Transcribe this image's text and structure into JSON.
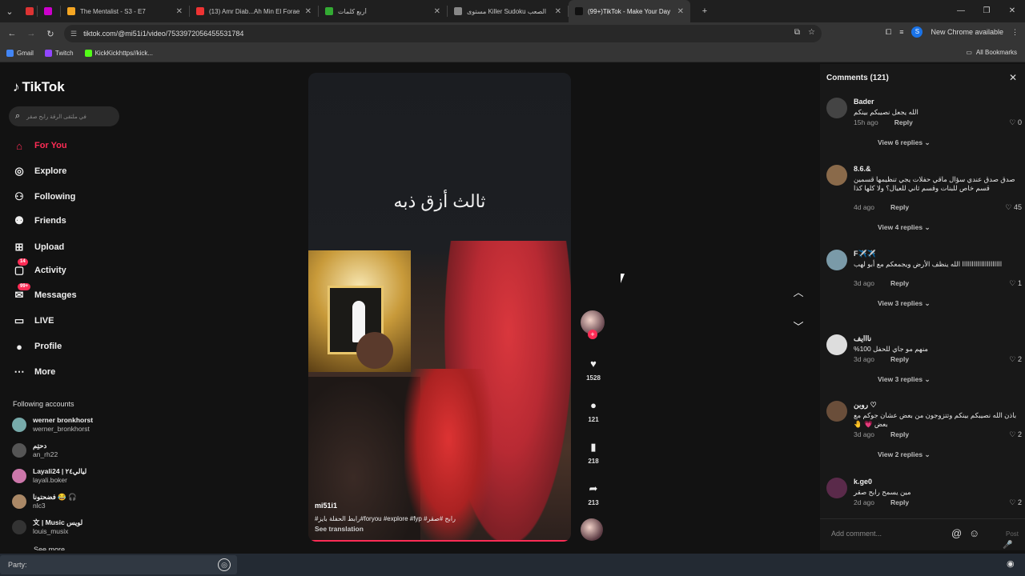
{
  "browser": {
    "tabs": [
      {
        "title": "",
        "color": "#d33"
      },
      {
        "title": "",
        "color": "#c0c"
      },
      {
        "title": "The Mentalist - S3 - E7",
        "color": "#f5a623"
      },
      {
        "title": "(13) Amr Diab...Ah Min El Forae",
        "color": "#e33"
      },
      {
        "title": "أربع كلمات",
        "color": "#3a3"
      },
      {
        "title": "مستوى Killer Sudoku الصعب",
        "color": "#888"
      },
      {
        "title": "(99+)TikTok - Make Your Day",
        "color": "#111"
      }
    ],
    "url": "tiktok.com/@mi51i1/video/7533972056455531784",
    "profile_letter": "S",
    "new_chrome": "New Chrome available",
    "bookmarks": [
      {
        "label": "Gmail",
        "color": "#4285f4"
      },
      {
        "label": "Twitch",
        "color": "#9146ff"
      },
      {
        "label": "KickKickhttps//kick...",
        "color": "#53fc18"
      }
    ],
    "all_bookmarks": "All Bookmarks"
  },
  "sidebar": {
    "logo": "TikTok",
    "search_placeholder": "في ملتقى الرقة رابح صقر",
    "nav": [
      {
        "label": "For You",
        "icon": "home-icon"
      },
      {
        "label": "Explore",
        "icon": "compass-icon"
      },
      {
        "label": "Following",
        "icon": "following-icon"
      },
      {
        "label": "Friends",
        "icon": "friends-icon"
      },
      {
        "label": "Upload",
        "icon": "upload-icon"
      },
      {
        "label": "Activity",
        "icon": "activity-icon",
        "badge": "14"
      },
      {
        "label": "Messages",
        "icon": "messages-icon",
        "badge": "99+"
      },
      {
        "label": "LIVE",
        "icon": "live-icon"
      },
      {
        "label": "Profile",
        "icon": "profile-icon"
      },
      {
        "label": "More",
        "icon": "more-icon"
      }
    ],
    "following_title": "Following accounts",
    "following": [
      {
        "name": "werner bronkhorst",
        "user": "werner_bronkhorst"
      },
      {
        "name": "دحتِم",
        "user": "an_rh22"
      },
      {
        "name": "Layali24 | ليالي٢٤",
        "user": "layali.boker"
      },
      {
        "name": "فضحتونا 😂 🎧",
        "user": "nlc3"
      },
      {
        "name": "文 | Music لويس",
        "user": "louis_musix"
      }
    ],
    "see_more": "See more"
  },
  "video": {
    "overlay_text": "ثالث أزق ذبه",
    "author": "mi51i1",
    "caption": "#رابط الحفلة بايز#foryou #explore #fyp #رابح #صقر",
    "see_translation": "See translation",
    "likes": "1528",
    "comments": "121",
    "saves": "218",
    "shares": "213"
  },
  "comments": {
    "title": "Comments (121)",
    "input_placeholder": "Add comment...",
    "post": "Post",
    "items": [
      {
        "author": "Bader",
        "text": "الله يجعل نصيبكم بينكم",
        "time": "15h ago",
        "likes": "0",
        "replies": "View 6 replies",
        "color": "#444"
      },
      {
        "author": "8.6.&",
        "text": "صدق صدق عندي سؤال ماقي حفلات يجي تنظيمها قسمين قسم خاص للبنات وقسم ثاني للعيال؟ ولا كلها كذا",
        "time": "4d ago",
        "likes": "45",
        "replies": "View 4 replies",
        "color": "#8a6a4a"
      },
      {
        "author": "F✈️✈️",
        "text": "ااااااااااااااااااااا الله ينظف الأرض ويجمعكم مع أبو لهب",
        "time": "3d ago",
        "likes": "1",
        "replies": "View 3 replies",
        "color": "#7a9aa8"
      },
      {
        "author": "نااايف",
        "text": "منهم مو جاي للحفل 100%",
        "time": "3d ago",
        "likes": "2",
        "replies": "View 3 replies",
        "color": "#ddd"
      },
      {
        "author": "روبن ♡",
        "text": "باذن الله نصيبكم بينكم وتتزوجون من بعض عشان جوكم مع بعض 💗 🤚",
        "time": "3d ago",
        "likes": "2",
        "replies": "View 2 replies",
        "color": "#6a4e3a"
      },
      {
        "author": "k.ge0",
        "text": "مين يسمح رابح صقر",
        "time": "2d ago",
        "likes": "2",
        "replies": "",
        "color": "#5a2a4a"
      }
    ],
    "reply_label": "Reply"
  },
  "bottombar": {
    "party_label": "Party:"
  }
}
